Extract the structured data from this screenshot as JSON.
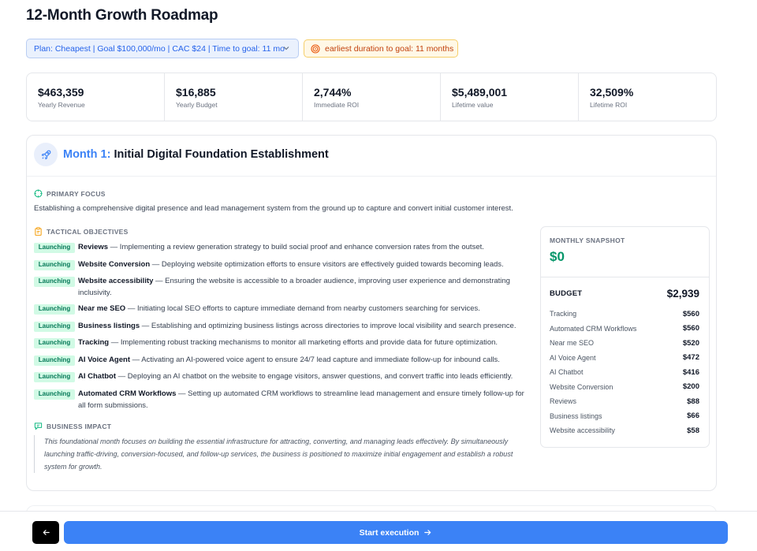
{
  "page": {
    "title": "12-Month Growth Roadmap"
  },
  "plan_select": {
    "value": "Plan: Cheapest | Goal $100,000/mo | CAC $24 | Time to goal: 11 mo"
  },
  "goal_badge": {
    "text": "earliest duration to goal: 11 months"
  },
  "stats": [
    {
      "value": "$463,359",
      "label": "Yearly Revenue"
    },
    {
      "value": "$16,885",
      "label": "Yearly Budget"
    },
    {
      "value": "2,744%",
      "label": "Immediate ROI"
    },
    {
      "value": "$5,489,001",
      "label": "Lifetime value"
    },
    {
      "value": "32,509%",
      "label": "Lifetime ROI"
    }
  ],
  "month": {
    "number_label": "Month 1:",
    "title": "Initial Digital Foundation Establishment",
    "primary_focus_label": "PRIMARY FOCUS",
    "primary_focus_text": "Establishing a comprehensive digital presence and lead management system from the ground up to capture and convert initial customer interest.",
    "tactical_label": "TACTICAL OBJECTIVES",
    "objectives": [
      {
        "tag": "Launching",
        "name": "Reviews",
        "desc": " — Implementing a review generation strategy to build social proof and enhance conversion rates from the outset."
      },
      {
        "tag": "Launching",
        "name": "Website Conversion",
        "desc": " — Deploying website optimization efforts to ensure visitors are effectively guided towards becoming leads."
      },
      {
        "tag": "Launching",
        "name": "Website accessibility",
        "desc": " — Ensuring the website is accessible to a broader audience, improving user experience and demonstrating inclusivity."
      },
      {
        "tag": "Launching",
        "name": "Near me SEO",
        "desc": " — Initiating local SEO efforts to capture immediate demand from nearby customers searching for services."
      },
      {
        "tag": "Launching",
        "name": "Business listings",
        "desc": " — Establishing and optimizing business listings across directories to improve local visibility and search presence."
      },
      {
        "tag": "Launching",
        "name": "Tracking",
        "desc": " — Implementing robust tracking mechanisms to monitor all marketing efforts and provide data for future optimization."
      },
      {
        "tag": "Launching",
        "name": "AI Voice Agent",
        "desc": " — Activating an AI-powered voice agent to ensure 24/7 lead capture and immediate follow-up for inbound calls."
      },
      {
        "tag": "Launching",
        "name": "AI Chatbot",
        "desc": " — Deploying an AI chatbot on the website to engage visitors, answer questions, and convert traffic into leads efficiently."
      },
      {
        "tag": "Launching",
        "name": "Automated CRM Workflows",
        "desc": " — Setting up automated CRM workflows to streamline lead management and ensure timely follow-up for all form submissions."
      }
    ],
    "impact_label": "BUSINESS IMPACT",
    "impact_text": "This foundational month focuses on building the essential infrastructure for attracting, converting, and managing leads effectively. By simultaneously launching traffic-driving, conversion-focused, and follow-up services, the business is positioned to maximize initial engagement and establish a robust system for growth."
  },
  "snapshot": {
    "label": "MONTHLY SNAPSHOT",
    "value": "$0",
    "budget_label": "BUDGET",
    "budget_total": "$2,939",
    "items": [
      {
        "name": "Tracking",
        "amount": "$560"
      },
      {
        "name": "Automated CRM Workflows",
        "amount": "$560"
      },
      {
        "name": "Near me SEO",
        "amount": "$520"
      },
      {
        "name": "AI Voice Agent",
        "amount": "$472"
      },
      {
        "name": "AI Chatbot",
        "amount": "$416"
      },
      {
        "name": "Website Conversion",
        "amount": "$200"
      },
      {
        "name": "Reviews",
        "amount": "$88"
      },
      {
        "name": "Business listings",
        "amount": "$66"
      },
      {
        "name": "Website accessibility",
        "amount": "$58"
      }
    ]
  },
  "footer": {
    "start_label": "Start execution"
  },
  "colors": {
    "accent": "#3b82f6",
    "success": "#059669",
    "warning_border": "#f6cf6a",
    "warning_text": "#c2410c"
  },
  "icons": {
    "plan_chevron": "chevron-down-icon",
    "goal": "target-icon",
    "month": "rocket-icon",
    "focus": "crosshair-icon",
    "tactical": "clipboard-icon",
    "impact": "message-icon",
    "back": "arrow-left-icon",
    "start": "arrow-right-icon"
  }
}
